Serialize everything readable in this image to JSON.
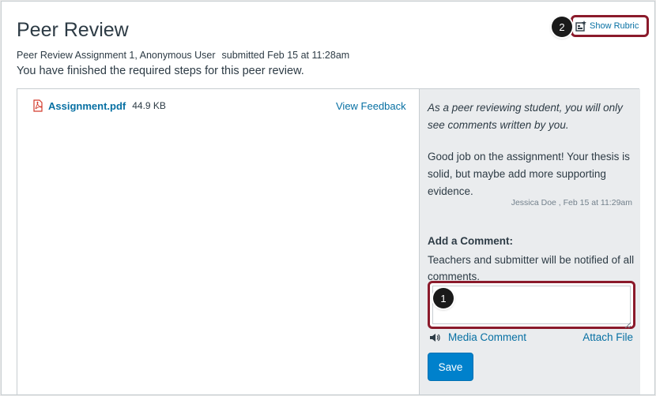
{
  "header": {
    "title": "Peer Review",
    "assignment": "Peer Review Assignment 1, Anonymous User",
    "submitted": "submitted Feb 15 at 11:28am",
    "status": "You have finished the required steps for this peer review."
  },
  "rubric": {
    "label": "Show Rubric",
    "icon": "rubric-icon"
  },
  "callouts": {
    "one": "1",
    "two": "2"
  },
  "file": {
    "name": "Assignment.pdf",
    "size": "44.9 KB",
    "icon": "pdf-icon",
    "view_feedback": "View Feedback"
  },
  "sidebar": {
    "notice": "As a peer reviewing student, you will only see comments written by you.",
    "comment": {
      "text": "Good job on the assignment! Your thesis is solid, but maybe add more supporting evidence.",
      "author_time": "Jessica Doe , Feb 15 at 11:29am"
    },
    "add_comment_label": "Add a Comment:",
    "add_comment_note": "Teachers and submitter will be notified of all comments.",
    "comment_value": "",
    "media_comment": "Media Comment",
    "attach_file": "Attach File",
    "save": "Save"
  },
  "colors": {
    "link": "#0770a3",
    "primary_button": "#0081cc",
    "highlight": "#8b1a2b",
    "sidebar_bg": "#eaecee",
    "text": "#2d3b45"
  }
}
